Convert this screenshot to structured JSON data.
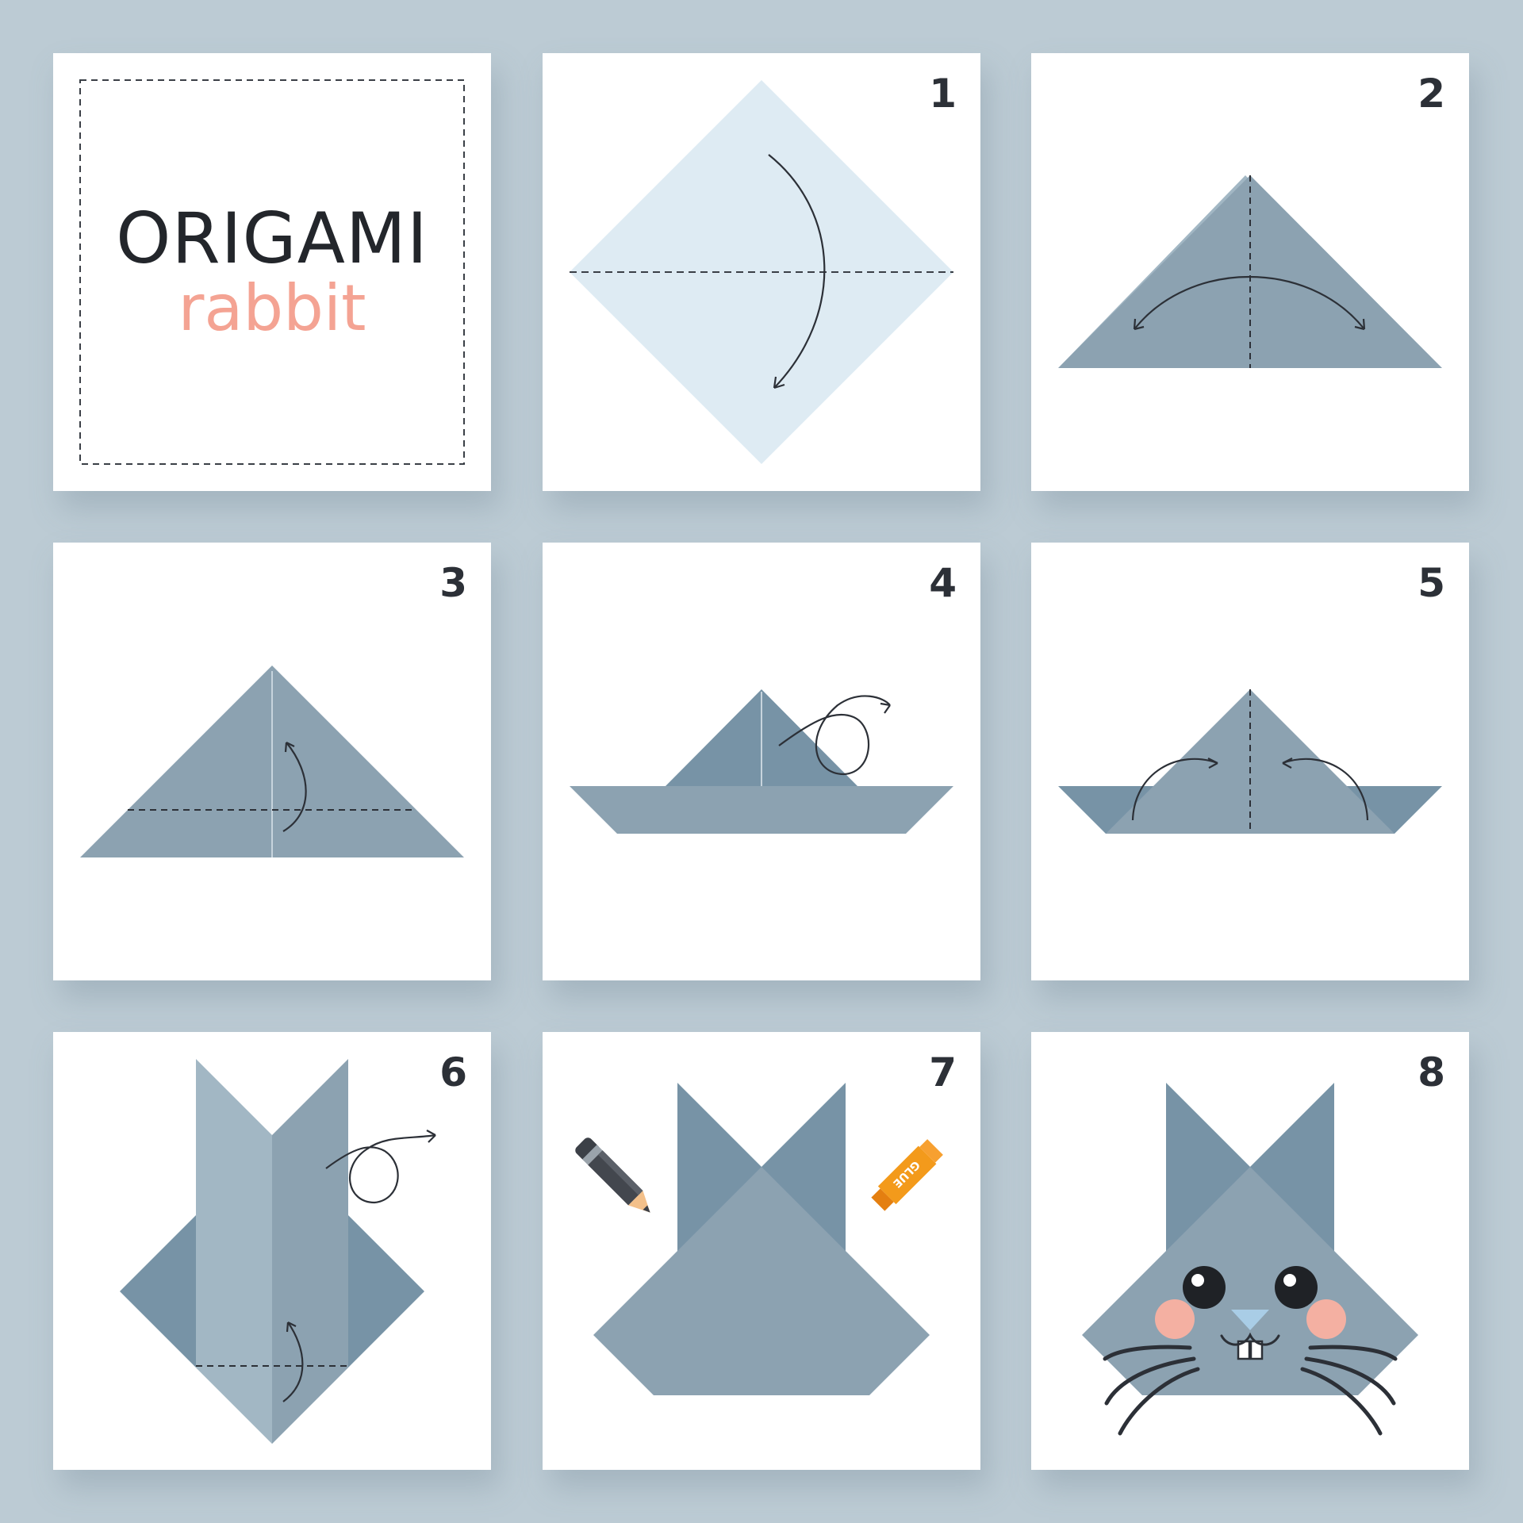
{
  "colors": {
    "background": "#bccbd4",
    "card": "#ffffff",
    "paper_light": "#deebf3",
    "paper_gray": "#8ca2b1",
    "paper_dark": "#7793a6",
    "paper_pale": "#a2b7c4",
    "title_accent": "#f4a393",
    "ink": "#2c3037"
  },
  "title": {
    "main": "ORIGAMI",
    "sub": "rabbit"
  },
  "steps": [
    {
      "number": "1"
    },
    {
      "number": "2"
    },
    {
      "number": "3"
    },
    {
      "number": "4"
    },
    {
      "number": "5"
    },
    {
      "number": "6"
    },
    {
      "number": "7"
    },
    {
      "number": "8"
    }
  ],
  "tools": {
    "glue_label": "GLUE"
  },
  "icons": [
    "fold-arrow-icon",
    "flip-over-icon",
    "pencil-icon",
    "glue-stick-icon"
  ]
}
